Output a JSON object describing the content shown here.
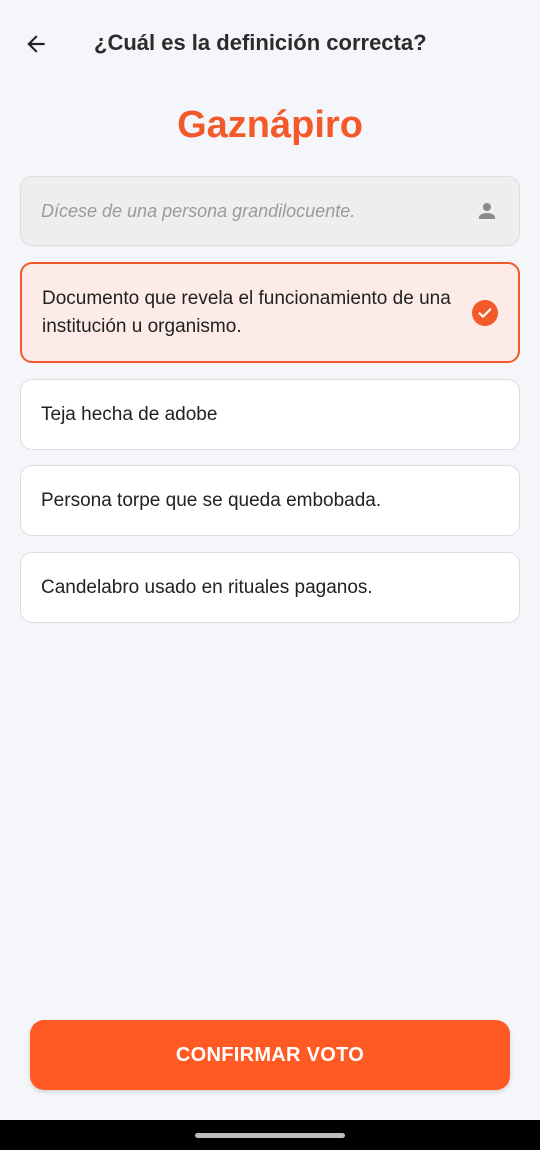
{
  "header": {
    "title": "¿Cuál es la definición correcta?",
    "back_icon": "arrow-left-icon"
  },
  "word": "Gaznápiro",
  "suggestion": {
    "placeholder": "Dícese de una persona grandilocuente.",
    "icon": "person-icon"
  },
  "options": [
    {
      "text": "Documento que revela el funcionamiento de una institución u organismo.",
      "selected": true
    },
    {
      "text": "Teja hecha de adobe",
      "selected": false
    },
    {
      "text": "Persona torpe que se queda embobada.",
      "selected": false
    },
    {
      "text": "Candelabro usado en rituales paganos.",
      "selected": false
    }
  ],
  "confirm_label": "CONFIRMAR VOTO",
  "colors": {
    "accent": "#f4592a",
    "selected_bg": "#fdebe8",
    "background": "#f5f6fa"
  }
}
